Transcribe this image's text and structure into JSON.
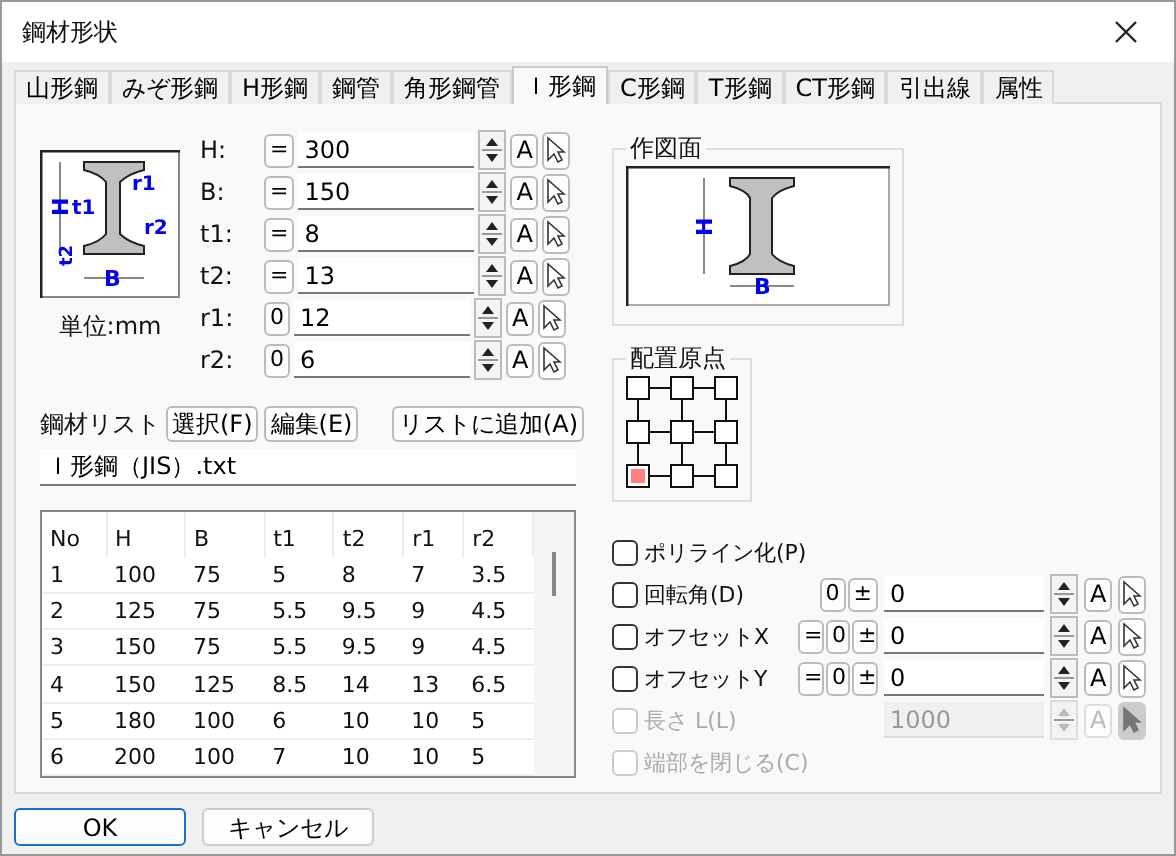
{
  "window": {
    "title": "鋼材形状"
  },
  "tabs": [
    {
      "label": "山形鋼",
      "selected": false
    },
    {
      "label": "みぞ形鋼",
      "selected": false
    },
    {
      "label": "H形鋼",
      "selected": false
    },
    {
      "label": "鋼管",
      "selected": false
    },
    {
      "label": "角形鋼管",
      "selected": false
    },
    {
      "label": "Ｉ形鋼",
      "selected": true
    },
    {
      "label": "C形鋼",
      "selected": false
    },
    {
      "label": "T形鋼",
      "selected": false
    },
    {
      "label": "CT形鋼",
      "selected": false
    },
    {
      "label": "引出線",
      "selected": false
    },
    {
      "label": "属性",
      "selected": false
    }
  ],
  "diagram_labels": {
    "h": "H",
    "b": "B",
    "t1": "t1",
    "t2": "t2",
    "r1": "r1",
    "r2": "r2"
  },
  "unit": "単位:mm",
  "params": [
    {
      "label": "H:",
      "mode": "=",
      "value": "300",
      "auto": "A"
    },
    {
      "label": "B:",
      "mode": "=",
      "value": "150",
      "auto": "A"
    },
    {
      "label": "t1:",
      "mode": "=",
      "value": "8",
      "auto": "A"
    },
    {
      "label": "t2:",
      "mode": "=",
      "value": "13",
      "auto": "A"
    },
    {
      "label": "r1:",
      "mode": "0",
      "value": "12",
      "auto": "A"
    },
    {
      "label": "r2:",
      "mode": "0",
      "value": "6",
      "auto": "A"
    }
  ],
  "steel_list": {
    "label": "鋼材リスト",
    "buttons": [
      "選択(F)",
      "編集(E)"
    ],
    "add_button": "リストに追加(A)",
    "file": "Ｉ形鋼（JIS）.txt"
  },
  "table": {
    "columns": [
      "No",
      "H",
      "B",
      "t1",
      "t2",
      "r1",
      "r2"
    ],
    "rows": [
      [
        "1",
        "100",
        "75",
        "5",
        "8",
        "7",
        "3.5"
      ],
      [
        "2",
        "125",
        "75",
        "5.5",
        "9.5",
        "9",
        "4.5"
      ],
      [
        "3",
        "150",
        "75",
        "5.5",
        "9.5",
        "9",
        "4.5"
      ],
      [
        "4",
        "150",
        "125",
        "8.5",
        "14",
        "13",
        "6.5"
      ],
      [
        "5",
        "180",
        "100",
        "6",
        "10",
        "10",
        "5"
      ],
      [
        "6",
        "200",
        "100",
        "7",
        "10",
        "10",
        "5"
      ]
    ]
  },
  "preview": {
    "title": "作図面",
    "h": "H",
    "b": "B"
  },
  "origin": {
    "title": "配置原点",
    "points": [
      {
        "selected": false
      },
      {
        "selected": false
      },
      {
        "selected": false
      },
      {
        "selected": false
      },
      {
        "selected": false
      },
      {
        "selected": false
      },
      {
        "selected": true
      },
      {
        "selected": false
      },
      {
        "selected": false
      }
    ]
  },
  "options": [
    {
      "label": "ポリライン化(P)",
      "checked": false,
      "disabled": false,
      "kind": "check"
    },
    {
      "label": "回転角(D)",
      "checked": false,
      "disabled": false,
      "kind": "field",
      "prefixes": [
        "0",
        "±"
      ],
      "value": "0",
      "auto": "A"
    },
    {
      "label": "オフセットX",
      "checked": false,
      "disabled": false,
      "kind": "field",
      "prefixes": [
        "=",
        "0",
        "±"
      ],
      "value": "0",
      "auto": "A"
    },
    {
      "label": "オフセットY",
      "checked": false,
      "disabled": false,
      "kind": "field",
      "prefixes": [
        "=",
        "0",
        "±"
      ],
      "value": "0",
      "auto": "A"
    },
    {
      "label": "長さ L(L)",
      "checked": false,
      "disabled": true,
      "kind": "field",
      "value": "1000",
      "auto": "A"
    },
    {
      "label": "端部を閉じる(C)",
      "checked": false,
      "disabled": true,
      "kind": "check"
    }
  ],
  "buttons": [
    {
      "label": "OK",
      "default": true
    },
    {
      "label": "キャンセル",
      "default": false
    }
  ]
}
